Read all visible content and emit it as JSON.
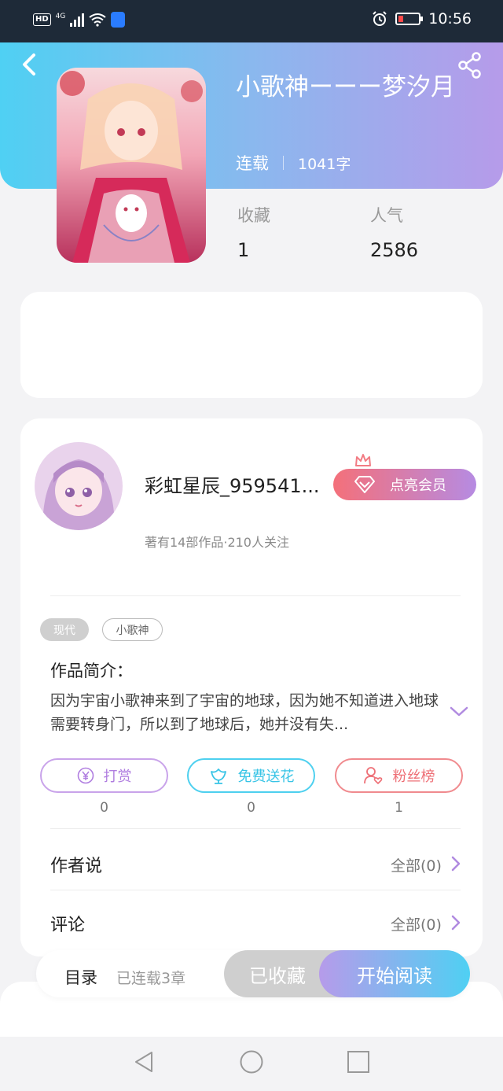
{
  "status_bar": {
    "network": "4G",
    "hd": "HD",
    "time": "10:56"
  },
  "book": {
    "title": "小歌神ーーー梦汐月",
    "status": "连载",
    "word_count": "1041字"
  },
  "stats": [
    {
      "label": "收藏",
      "value": "1"
    },
    {
      "label": "人气",
      "value": "2586"
    }
  ],
  "author": {
    "name": "彩虹星辰_959541...",
    "meta": "著有14部作品·210人关注",
    "vip_label": "点亮会员"
  },
  "tags": [
    "现代",
    "小歌神"
  ],
  "intro": {
    "label": "作品简介：",
    "text": "因为宇宙小歌神来到了宇宙的地球，因为她不知道进入地球需要转身门，所以到了地球后，她并没有失..."
  },
  "actions": [
    {
      "label": "打赏",
      "count": "0",
      "icon": "yen-icon",
      "color": "#b07ee0"
    },
    {
      "label": "免费送花",
      "count": "0",
      "icon": "flower-icon",
      "color": "#38c4e6"
    },
    {
      "label": "粉丝榜",
      "count": "1",
      "icon": "fan-ranking-icon",
      "color": "#ee7077"
    }
  ],
  "author_says": {
    "label": "作者说",
    "more": "全部(0)"
  },
  "comments": {
    "label": "评论",
    "more": "全部(0)"
  },
  "bottom": {
    "toc_label": "目录",
    "toc_sub": "已连载3章",
    "collected_label": "已收藏",
    "read_label": "开始阅读"
  },
  "colors": {
    "header_start": "#4fd0f3",
    "header_end": "#b69bea",
    "vip_start": "#f4707a",
    "vip_end": "#b68be2"
  }
}
